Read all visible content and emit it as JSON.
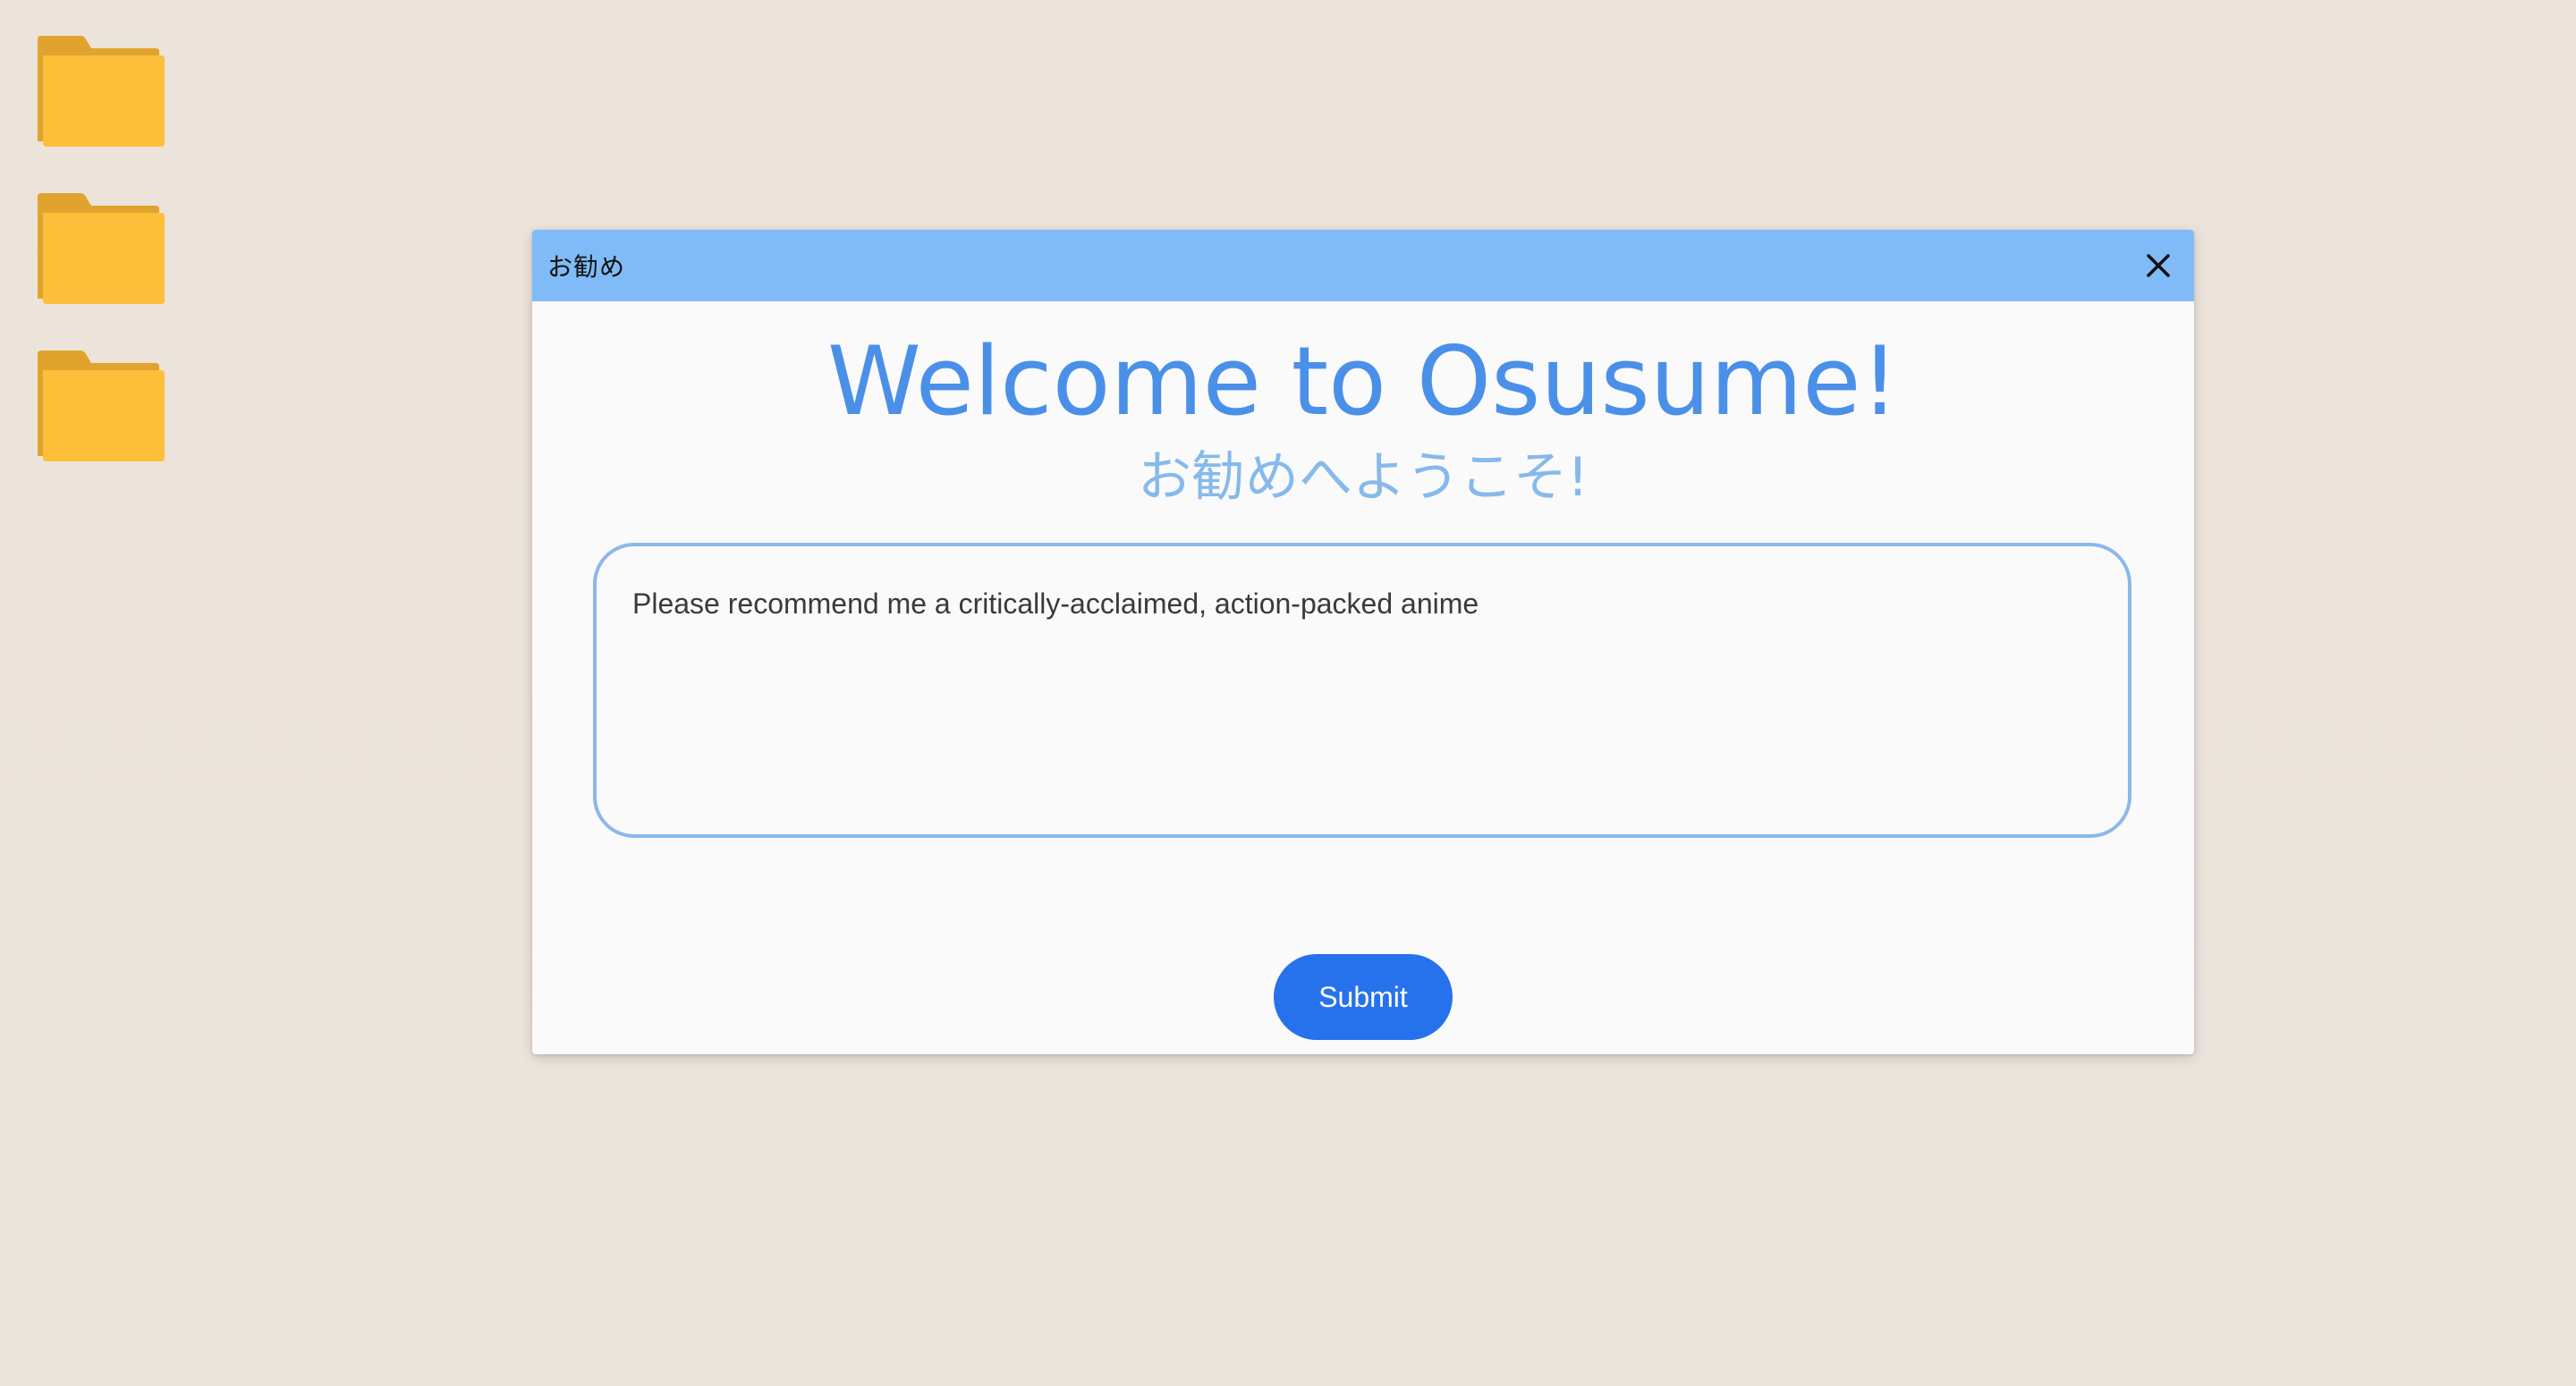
{
  "desktop": {
    "icons": [
      {
        "icon": "folder-icon"
      },
      {
        "icon": "folder-icon"
      },
      {
        "icon": "folder-icon"
      }
    ],
    "background_color": "#ece3da"
  },
  "window": {
    "title": "お勧め",
    "titlebar_color": "#80bbf8",
    "close_icon": "close-icon",
    "heading": "Welcome to Osusume!",
    "subheading": "お勧めへようこそ!",
    "prompt_input": {
      "value": "Please recommend me a critically-acclaimed, action-packed anime"
    },
    "submit_label": "Submit",
    "accent_color": "#4a90e8",
    "button_color": "#2672ec"
  }
}
